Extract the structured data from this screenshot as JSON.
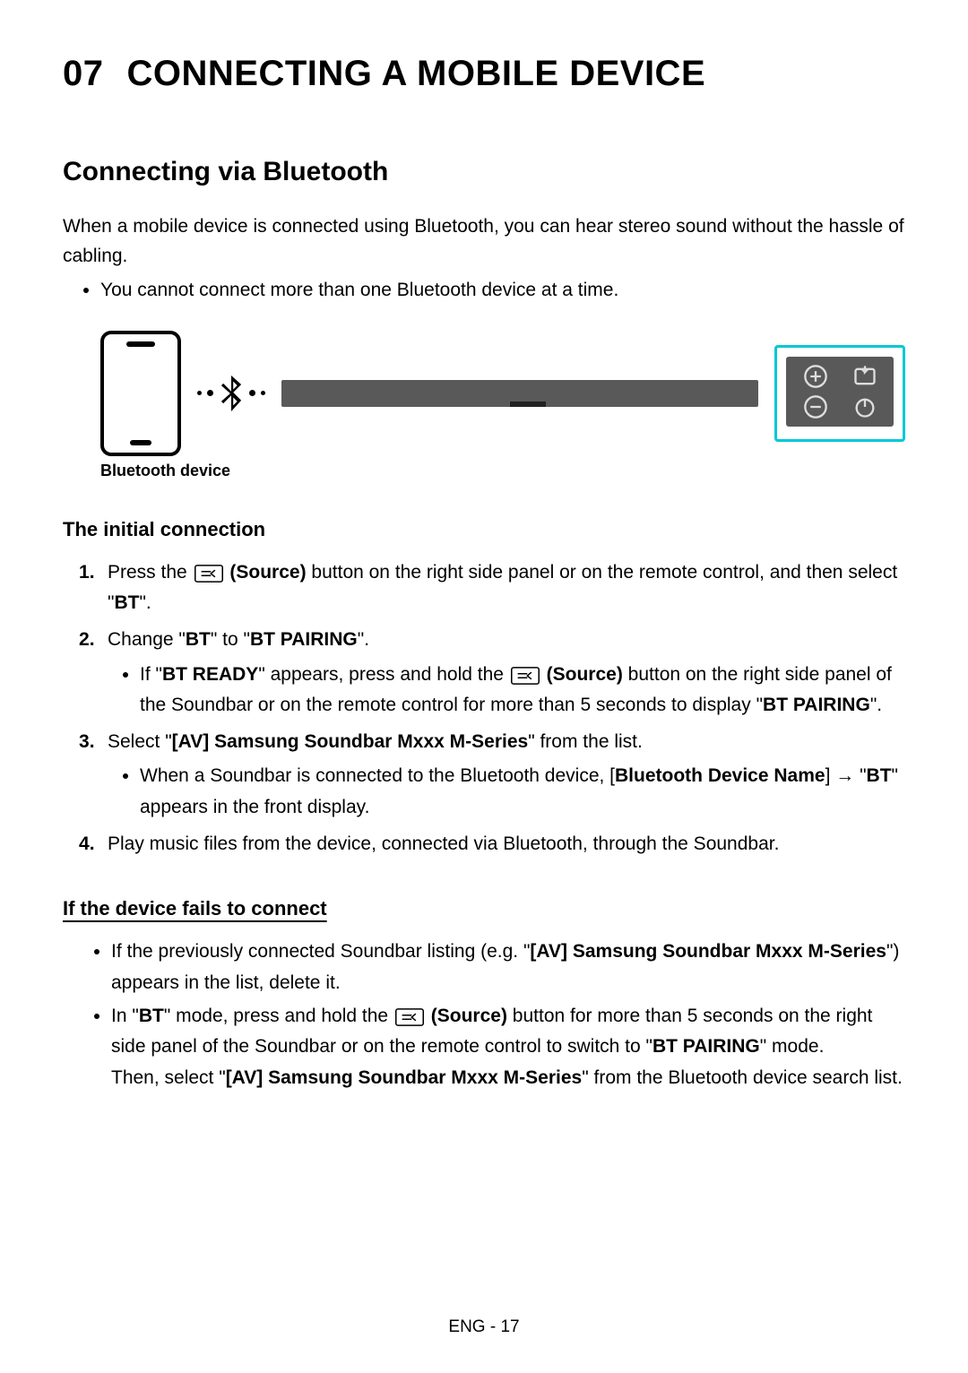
{
  "chapter": {
    "number": "07",
    "title": "CONNECTING A MOBILE DEVICE"
  },
  "section": {
    "title": "Connecting via Bluetooth",
    "intro": "When a mobile device is connected using Bluetooth, you can hear stereo sound without the hassle of cabling.",
    "limit": "You cannot connect more than one Bluetooth device at a time.",
    "device_label": "Bluetooth device"
  },
  "initial": {
    "heading": "The initial connection",
    "step1_a": "Press the ",
    "source_label": "(Source)",
    "step1_b": " button on the right side panel or on the remote control, and then select \"",
    "bt": "BT",
    "step1_c": "\".",
    "step2_a": "Change \"",
    "step2_b": "\" to \"",
    "bt_pairing": "BT PAIRING",
    "step2_c": "\".",
    "step2_sub_a": "If \"",
    "bt_ready": "BT READY",
    "step2_sub_b": "\" appears, press and hold the ",
    "step2_sub_c": " button on the right side panel of the Soundbar or on the remote control for more than 5 seconds to display \"",
    "step2_sub_d": "\".",
    "step3_a": "Select \"",
    "av_name": "[AV] Samsung Soundbar Mxxx M-Series",
    "step3_b": "\" from the list.",
    "step3_sub_a": "When a Soundbar is connected to the Bluetooth device, [",
    "bdn": "Bluetooth Device Name",
    "step3_sub_b": "] → \"",
    "step3_sub_c": "\" appears in the front display.",
    "step4": "Play music files from the device, connected via Bluetooth, through the Soundbar."
  },
  "fails": {
    "heading": "If the device fails to connect",
    "b1_a": "If the previously connected Soundbar listing (e.g. \"",
    "b1_b": "\") appears in the list, delete it.",
    "b2_a": "In \"",
    "b2_b": "\" mode, press and hold the ",
    "b2_c": " button for more than 5 seconds on the right side panel of the Soundbar or on the remote control to switch to \"",
    "b2_d": "\" mode.",
    "b2_then_a": "Then, select \"",
    "b2_then_b": "\" from the Bluetooth device search list."
  },
  "footer": "ENG - 17"
}
